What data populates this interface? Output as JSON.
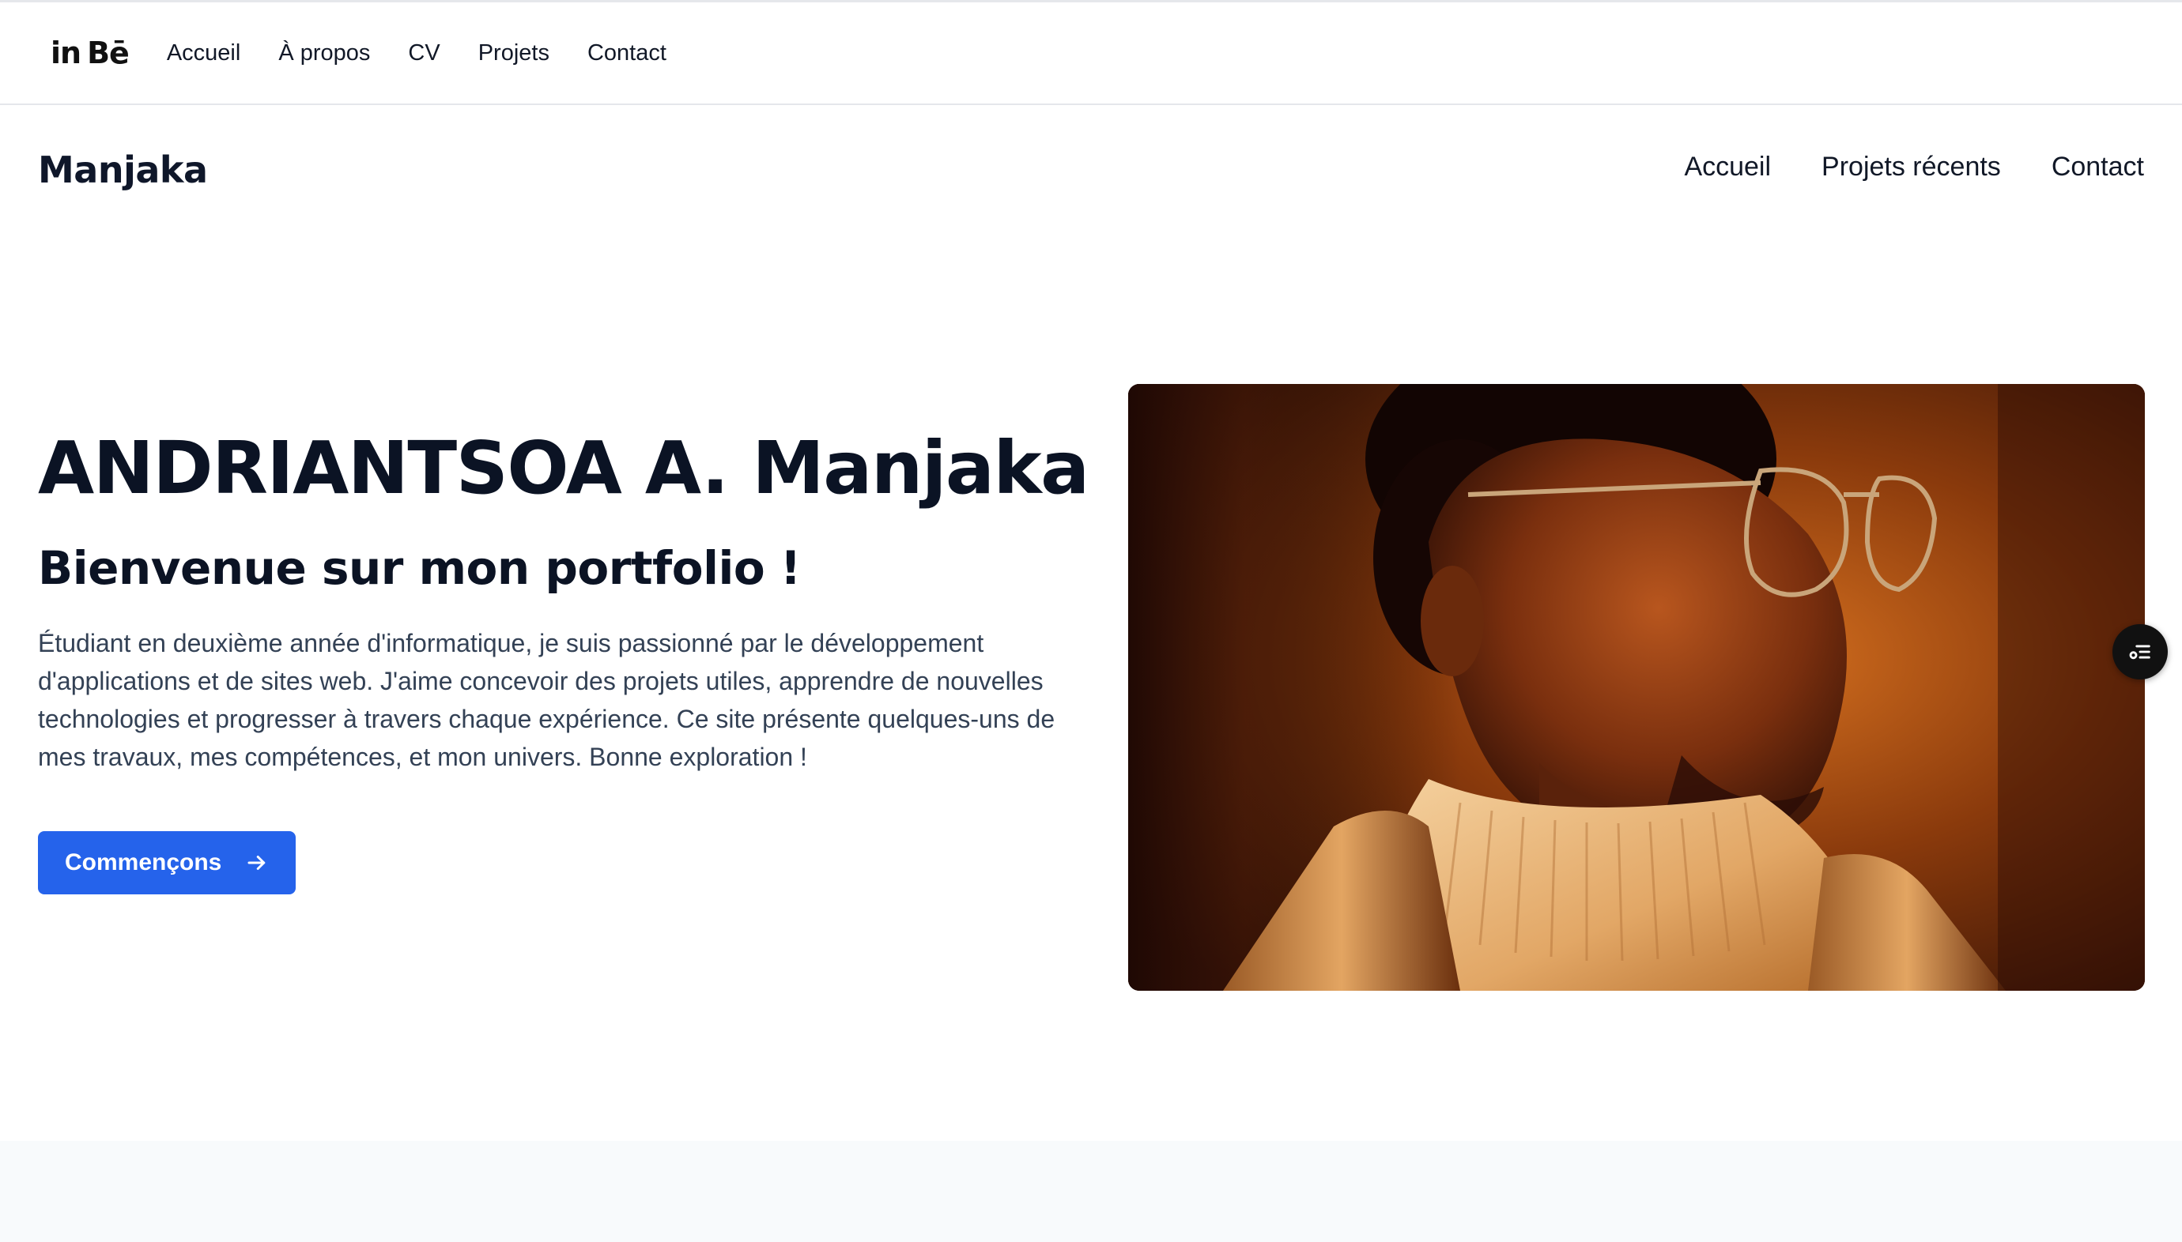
{
  "top_bar": {
    "social": {
      "linkedin": "in",
      "behance": "Bē"
    },
    "nav": [
      "Accueil",
      "À propos",
      "CV",
      "Projets",
      "Contact"
    ]
  },
  "header": {
    "brand": "Manjaka",
    "nav": [
      "Accueil",
      "Projets récents",
      "Contact"
    ]
  },
  "hero": {
    "name": "ANDRIANTSOA A. Manjaka",
    "subtitle": "Bienvenue sur mon portfolio !",
    "paragraph": "Étudiant en deuxième année d'informatique, je suis passionné par le développement d'applications et de sites web. J'aime concevoir des projets utiles, apprendre de nouvelles technologies et progresser à travers chaque expérience. Ce site présente quelques-uns de mes travaux, mes compétences, et mon univers. Bonne exploration !",
    "cta_label": "Commençons",
    "cta_icon": "arrow-right-icon"
  },
  "floating_widget": {
    "icon": "settings-list-icon"
  },
  "colors": {
    "accent": "#2563eb",
    "heading": "#0b1324",
    "body_text": "#334155",
    "bottom_band": "#f8fafc"
  }
}
